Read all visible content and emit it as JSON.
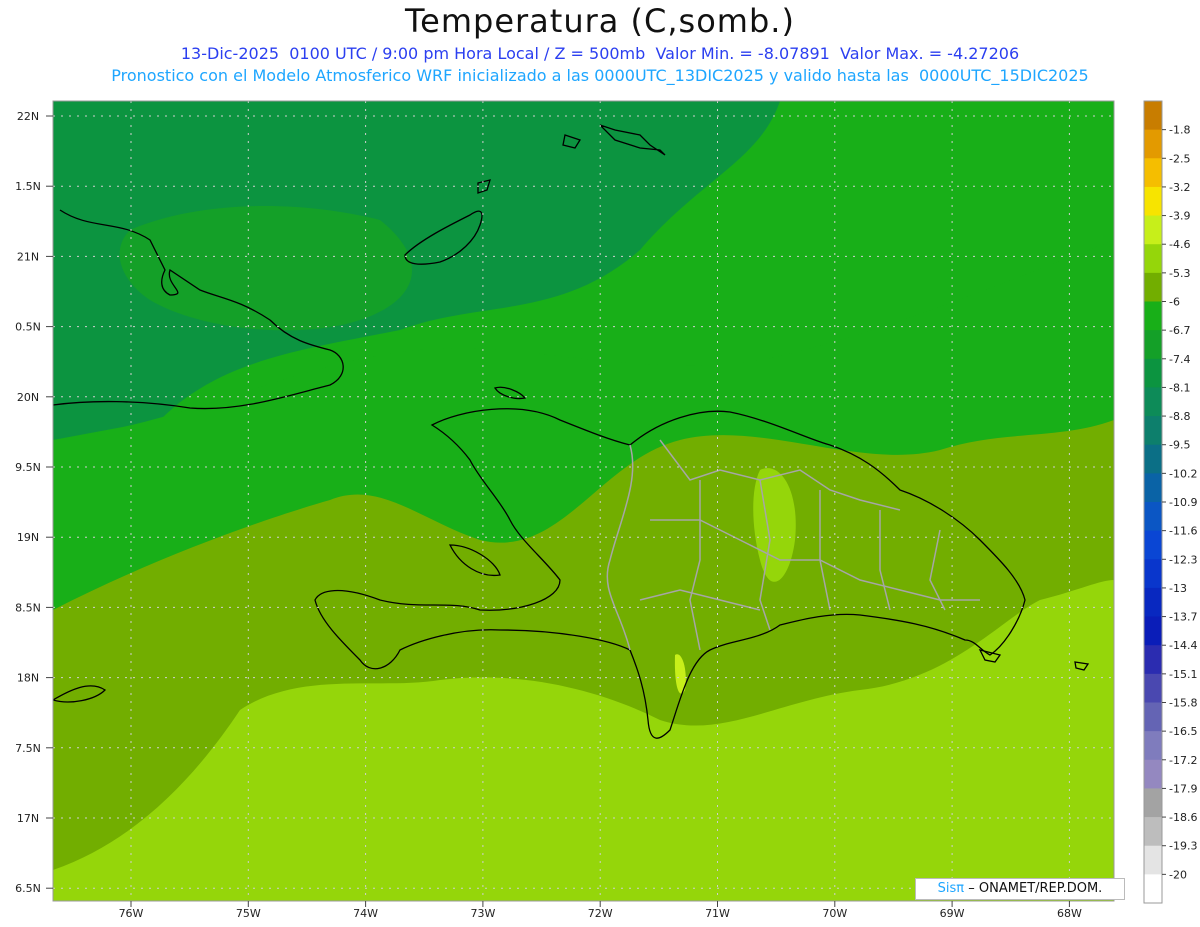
{
  "header": {
    "title": "Temperatura (C,somb.)",
    "line1": "13-Dic-2025  0100 UTC / 9:00 pm Hora Local / Z = 500mb  Valor Min. = -8.07891  Valor Max. = -4.27206",
    "line2": "Pronostico con el Modelo Atmosferico WRF inicializado a las 0000UTC_13DIC2025 y valido hasta las  0000UTC_15DIC2025"
  },
  "credit": {
    "prefix": "Sisπ",
    "text": "– ONAMET/REP.DOM."
  },
  "axes": {
    "lat_labels": [
      "22N",
      "1.5N",
      "21N",
      "0.5N",
      "20N",
      "9.5N",
      "19N",
      "8.5N",
      "18N",
      "7.5N",
      "17N",
      "6.5N"
    ],
    "lon_labels": [
      "76W",
      "75W",
      "74W",
      "73W",
      "72W",
      "71W",
      "70W",
      "69W",
      "68W"
    ]
  },
  "colorbar": {
    "labels": [
      "-1.8",
      "-2.5",
      "-3.2",
      "-3.9",
      "-4.6",
      "-5.3",
      "-6",
      "-6.7",
      "-7.4",
      "-8.1",
      "-8.8",
      "-9.5",
      "-10.2",
      "-10.9",
      "-11.6",
      "-12.3",
      "-13",
      "-13.7",
      "-14.4",
      "-15.1",
      "-15.8",
      "-16.5",
      "-17.2",
      "-17.9",
      "-18.6",
      "-19.3",
      "-20"
    ],
    "colors": [
      "#c87d00",
      "#e39a00",
      "#f5be00",
      "#f7e400",
      "#c7ef1a",
      "#95d60a",
      "#72ae00",
      "#18af18",
      "#14a028",
      "#0c9440",
      "#0d8b58",
      "#0d7f6c",
      "#0b6f86",
      "#0a63a6",
      "#0b56c4",
      "#0a46d4",
      "#0936cc",
      "#0828c0",
      "#0a1db8",
      "#2b2cb0",
      "#4a48b0",
      "#6464b4",
      "#7f7cbd",
      "#9488c0",
      "#a3a3a3",
      "#bdbdbd",
      "#e4e4e4",
      "#ffffff"
    ]
  }
}
